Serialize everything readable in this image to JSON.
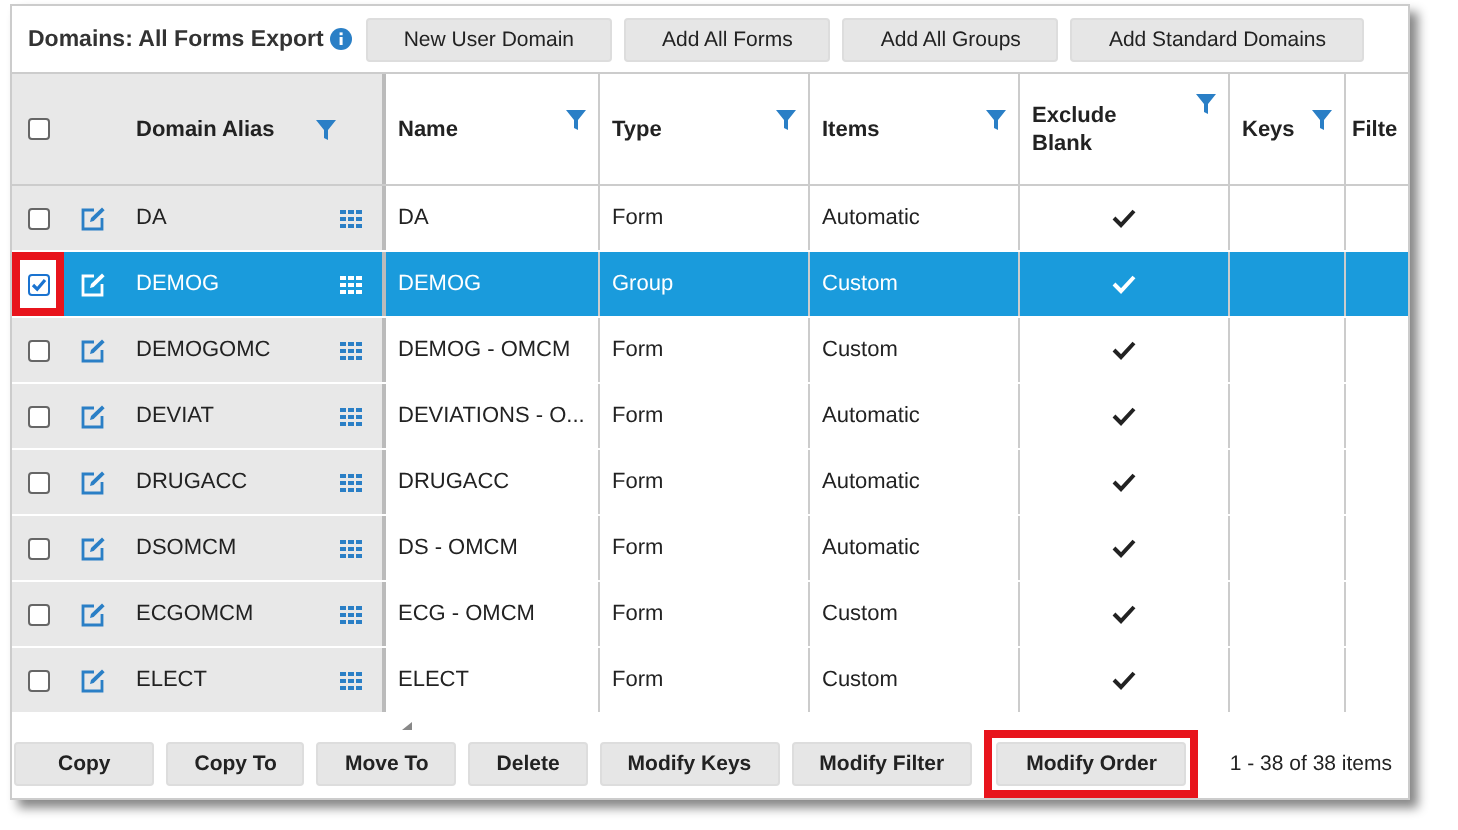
{
  "toolbar": {
    "title": "Domains: All Forms Export",
    "buttons": [
      "New User Domain",
      "Add All Forms",
      "Add All Groups",
      "Add Standard Domains"
    ]
  },
  "table": {
    "all_selected": false,
    "columns": [
      "Domain Alias",
      "Name",
      "Type",
      "Items",
      "Exclude Blank",
      "Keys",
      "Filte"
    ],
    "rows": [
      {
        "alias": "DA",
        "name": "DA",
        "type": "Form",
        "items": "Automatic",
        "exclude_blank": true,
        "selected": false,
        "highlighted": false
      },
      {
        "alias": "DEMOG",
        "name": "DEMOG",
        "type": "Group",
        "items": "Custom",
        "exclude_blank": true,
        "selected": true,
        "highlighted": true
      },
      {
        "alias": "DEMOGOMC",
        "name": "DEMOG - OMCM",
        "type": "Form",
        "items": "Custom",
        "exclude_blank": true,
        "selected": false,
        "highlighted": false
      },
      {
        "alias": "DEVIAT",
        "name": "DEVIATIONS - O...",
        "type": "Form",
        "items": "Automatic",
        "exclude_blank": true,
        "selected": false,
        "highlighted": false
      },
      {
        "alias": "DRUGACC",
        "name": "DRUGACC",
        "type": "Form",
        "items": "Automatic",
        "exclude_blank": true,
        "selected": false,
        "highlighted": false
      },
      {
        "alias": "DSOMCM",
        "name": "DS - OMCM",
        "type": "Form",
        "items": "Automatic",
        "exclude_blank": true,
        "selected": false,
        "highlighted": false
      },
      {
        "alias": "ECGOMCM",
        "name": "ECG - OMCM",
        "type": "Form",
        "items": "Custom",
        "exclude_blank": true,
        "selected": false,
        "highlighted": false
      },
      {
        "alias": "ELECT",
        "name": "ELECT",
        "type": "Form",
        "items": "Custom",
        "exclude_blank": true,
        "selected": false,
        "highlighted": false
      }
    ]
  },
  "footer": {
    "buttons": [
      {
        "label": "Copy",
        "highlighted": false
      },
      {
        "label": "Copy To",
        "highlighted": false
      },
      {
        "label": "Move To",
        "highlighted": false
      },
      {
        "label": "Delete",
        "highlighted": false
      },
      {
        "label": "Modify Keys",
        "highlighted": false
      },
      {
        "label": "Modify Filter",
        "highlighted": false
      },
      {
        "label": "Modify Order",
        "highlighted": true
      }
    ],
    "pager": "1 - 38 of 38 items"
  }
}
